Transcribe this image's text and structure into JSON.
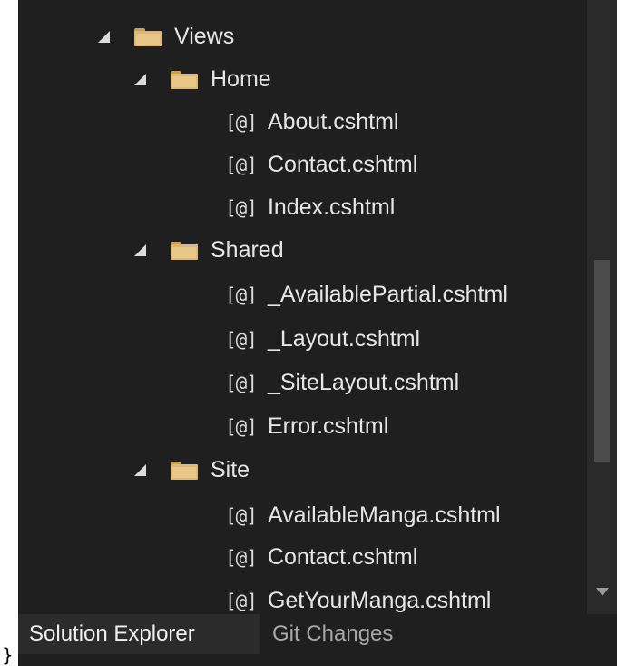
{
  "stray_text": "}",
  "tree": {
    "items": [
      {
        "label": "Views",
        "kind": "folder",
        "expanded": true,
        "icon": "folder-icon"
      },
      {
        "label": "Home",
        "kind": "folder",
        "expanded": true,
        "icon": "folder-icon"
      },
      {
        "label": "About.cshtml",
        "kind": "file",
        "icon_text": "[@]"
      },
      {
        "label": "Contact.cshtml",
        "kind": "file",
        "icon_text": "[@]"
      },
      {
        "label": "Index.cshtml",
        "kind": "file",
        "icon_text": "[@]"
      },
      {
        "label": "Shared",
        "kind": "folder",
        "expanded": true,
        "icon": "folder-icon"
      },
      {
        "label": "_AvailablePartial.cshtml",
        "kind": "file",
        "icon_text": "[@]"
      },
      {
        "label": "_Layout.cshtml",
        "kind": "file",
        "icon_text": "[@]"
      },
      {
        "label": "_SiteLayout.cshtml",
        "kind": "file",
        "icon_text": "[@]"
      },
      {
        "label": "Error.cshtml",
        "kind": "file",
        "icon_text": "[@]"
      },
      {
        "label": "Site",
        "kind": "folder",
        "expanded": true,
        "icon": "folder-icon"
      },
      {
        "label": "AvailableManga.cshtml",
        "kind": "file",
        "icon_text": "[@]"
      },
      {
        "label": "Contact.cshtml",
        "kind": "file",
        "icon_text": "[@]"
      },
      {
        "label": "GetYourManga.cshtml",
        "kind": "file",
        "icon_text": "[@]"
      }
    ]
  },
  "tabs": [
    {
      "label": "Solution Explorer",
      "active": true
    },
    {
      "label": "Git Changes",
      "active": false
    }
  ],
  "colors": {
    "panel_bg": "#1f1f1f",
    "folder": "#dcb67a",
    "text": "#e6e6e6",
    "inactive_tab_text": "#a8a8a8"
  }
}
